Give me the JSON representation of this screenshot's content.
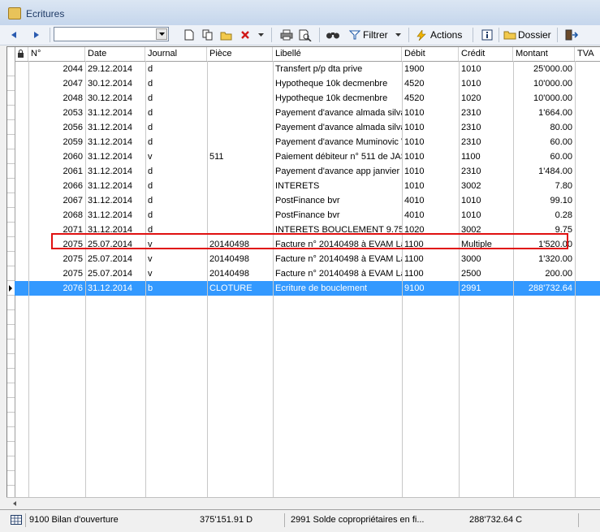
{
  "window": {
    "title": "Ecritures"
  },
  "toolbar": {
    "filter_label": "Filtrer",
    "actions_label": "Actions",
    "folder_label": "Dossier",
    "search_value": ""
  },
  "table": {
    "columns": [
      "N°",
      "Date",
      "Journal",
      "Pièce",
      "Libellé",
      "Débit",
      "Crédit",
      "Montant",
      "TVA"
    ],
    "rows": [
      [
        "2044",
        "29.12.2014",
        "d",
        "",
        "Transfert p/p dta prive",
        "1900",
        "1010",
        "25'000.00",
        ""
      ],
      [
        "2047",
        "30.12.2014",
        "d",
        "",
        "Hypotheque 10k decmenbre",
        "4520",
        "1010",
        "10'000.00",
        ""
      ],
      [
        "2048",
        "30.12.2014",
        "d",
        "",
        "Hypotheque 10k decmenbre",
        "4520",
        "1020",
        "10'000.00",
        ""
      ],
      [
        "2053",
        "31.12.2014",
        "d",
        "",
        "Payement d'avance almada silva",
        "1010",
        "2310",
        "1'664.00",
        ""
      ],
      [
        "2056",
        "31.12.2014",
        "d",
        "",
        "Payement d'avance almada silva",
        "1010",
        "2310",
        "80.00",
        ""
      ],
      [
        "2059",
        "31.12.2014",
        "d",
        "",
        "Payement d'avance Muminovic V",
        "1010",
        "2310",
        "60.00",
        ""
      ],
      [
        "2060",
        "31.12.2014",
        "v",
        "511",
        "Paiement débiteur n° 511 de JAS",
        "1010",
        "1100",
        "60.00",
        ""
      ],
      [
        "2061",
        "31.12.2014",
        "d",
        "",
        "Payement d'avance app janvier M",
        "1010",
        "2310",
        "1'484.00",
        ""
      ],
      [
        "2066",
        "31.12.2014",
        "d",
        "",
        "INTERETS",
        "1010",
        "3002",
        "7.80",
        ""
      ],
      [
        "2067",
        "31.12.2014",
        "d",
        "",
        "PostFinance bvr",
        "4010",
        "1010",
        "99.10",
        ""
      ],
      [
        "2068",
        "31.12.2014",
        "d",
        "",
        "PostFinance bvr",
        "4010",
        "1010",
        "0.28",
        ""
      ],
      [
        "2071",
        "31.12.2014",
        "d",
        "",
        "INTERETS BOUCLEMENT 9.75",
        "1020",
        "3002",
        "9.75",
        ""
      ],
      [
        "2075",
        "25.07.2014",
        "v",
        "20140498",
        "Facture n° 20140498 à EVAM La",
        "1100",
        "Multiple",
        "1'520.00",
        ""
      ],
      [
        "2075",
        "25.07.2014",
        "v",
        "20140498",
        "Facture n° 20140498 à EVAM La",
        "1100",
        "3000",
        "1'320.00",
        ""
      ],
      [
        "2075",
        "25.07.2014",
        "v",
        "20140498",
        "Facture n° 20140498 à EVAM La",
        "1100",
        "2500",
        "200.00",
        ""
      ],
      [
        "2076",
        "31.12.2014",
        "b",
        "CLOTURE",
        "Ecriture de bouclement",
        "9100",
        "2991",
        "288'732.64",
        ""
      ]
    ],
    "selected_index": 15
  },
  "status": {
    "debit_account": "9100 Bilan d'ouverture",
    "debit_amount": "375'151.91 D",
    "credit_account": "2991 Solde copropriétaires en fi...",
    "credit_amount": "288'732.64 C"
  },
  "colors": {
    "selection": "#3399ff",
    "highlight_box": "#e01010"
  }
}
